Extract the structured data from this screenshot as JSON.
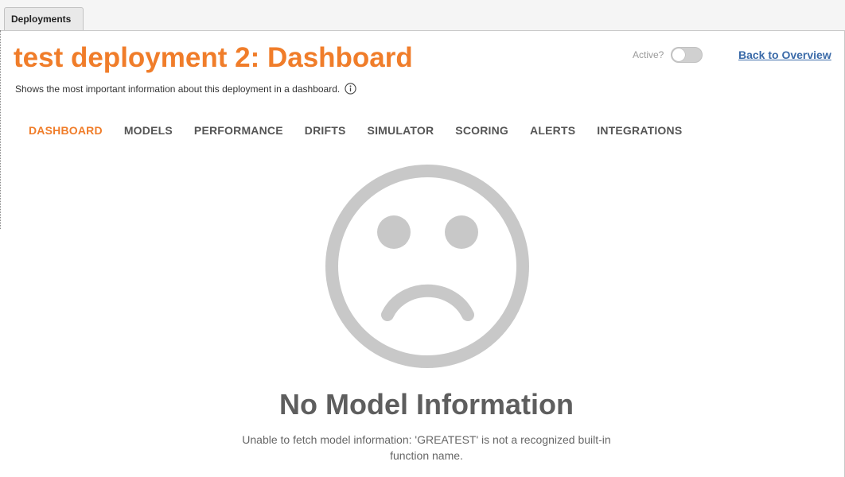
{
  "tabs": {
    "active_tab_label": "Deployments"
  },
  "header": {
    "title": "test deployment 2: Dashboard",
    "subtitle": "Shows the most important information about this deployment in a dashboard.",
    "active_label": "Active?",
    "active_state": false,
    "back_link_label": "Back to Overview"
  },
  "nav": {
    "items": [
      {
        "label": "DASHBOARD",
        "active": true
      },
      {
        "label": "MODELS",
        "active": false
      },
      {
        "label": "PERFORMANCE",
        "active": false
      },
      {
        "label": "DRIFTS",
        "active": false
      },
      {
        "label": "SIMULATOR",
        "active": false
      },
      {
        "label": "SCORING",
        "active": false
      },
      {
        "label": "ALERTS",
        "active": false
      },
      {
        "label": "INTEGRATIONS",
        "active": false
      }
    ]
  },
  "empty_state": {
    "icon": "sad-face-icon",
    "title": "No Model Information",
    "message": "Unable to fetch model information: 'GREATEST' is not a recognized built-in function name."
  },
  "colors": {
    "accent": "#f07d2a",
    "link": "#3a6aa8",
    "icon_gray": "#c8c8c8"
  }
}
